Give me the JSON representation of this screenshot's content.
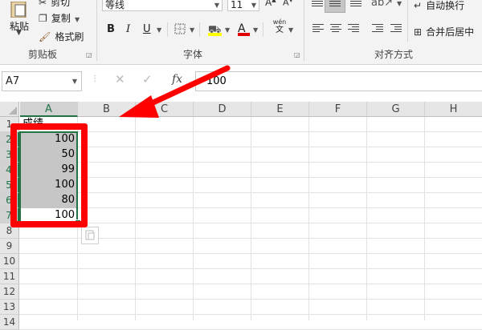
{
  "ribbon": {
    "clipboard": {
      "paste": "粘贴",
      "cut": "剪切",
      "copy": "复制",
      "format_painter": "格式刷",
      "group": "剪贴板"
    },
    "font": {
      "name": "等线",
      "size": "11",
      "bold": "B",
      "italic": "I",
      "underline": "U",
      "wen": "wén",
      "wen_char": "文",
      "group": "字体"
    },
    "alignment": {
      "wrap_text": "自动换行",
      "merge_center": "合并后居中",
      "group": "对齐方式"
    }
  },
  "formula_bar": {
    "name_box": "A7",
    "fx": "fx",
    "value": "100"
  },
  "columns": [
    "A",
    "B",
    "C",
    "D",
    "E",
    "F",
    "G",
    "H"
  ],
  "rows": [
    "1",
    "2",
    "3",
    "4",
    "5",
    "6",
    "7",
    "8",
    "9",
    "10",
    "11",
    "12",
    "13",
    "14"
  ],
  "cells": {
    "A1": "成绩",
    "A2": "100",
    "A3": "50",
    "A4": "99",
    "A5": "100",
    "A6": "80",
    "A7": "100"
  },
  "colors": {
    "annotation": "#ff0000",
    "selection_border": "#217346",
    "selection_fill": "#c6c6c6"
  }
}
